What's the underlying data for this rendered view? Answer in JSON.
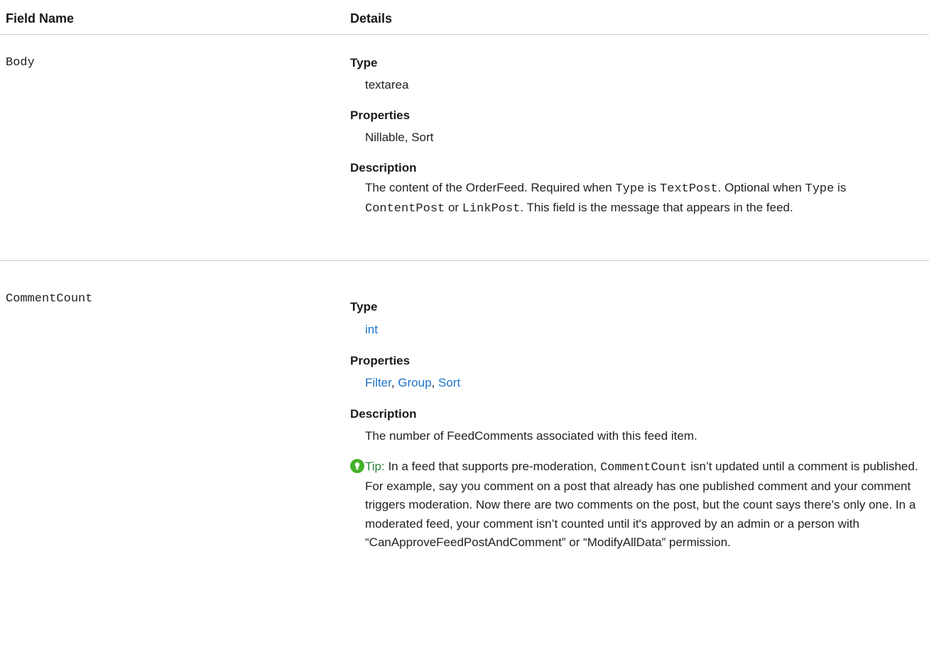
{
  "header": {
    "field_name": "Field Name",
    "details": "Details"
  },
  "labels": {
    "type": "Type",
    "properties": "Properties",
    "description": "Description"
  },
  "rows": [
    {
      "field": "Body",
      "type": "textarea",
      "properties": "Nillable, Sort",
      "description": {
        "p1": "The content of the OrderFeed. Required when ",
        "c1": "Type",
        "p2": " is ",
        "c2": "TextPost",
        "p3": ". Optional when ",
        "c3": "Type",
        "p4": " is ",
        "c4": "ContentPost",
        "p5": " or ",
        "c5": "LinkPost",
        "p6": ". This field is the message that appears in the feed."
      }
    },
    {
      "field": "CommentCount",
      "type": "int",
      "properties": [
        "Filter",
        "Group",
        "Sort"
      ],
      "property_separator": ", ",
      "description": "The number of FeedComments associated with this feed item.",
      "tip": {
        "icon": "lightbulb-icon",
        "label": "Tip:",
        "p1": " In a feed that supports pre-moderation, ",
        "code": "CommentCount",
        "p2": " isn’t updated until a comment is published. For example, say you comment on a post that already has one published comment and your comment triggers moderation. Now there are two comments on the post, but the count says there's only one. In a moderated feed, your comment isn’t counted until it's approved by an admin or a person with “CanApproveFeedPostAndComment” or “ModifyAllData” permission."
      }
    }
  ],
  "colors": {
    "link": "#1b73c9",
    "tip_icon": "#43b02a",
    "tip_label": "#2e8540",
    "divider": "#cfcfcf"
  }
}
